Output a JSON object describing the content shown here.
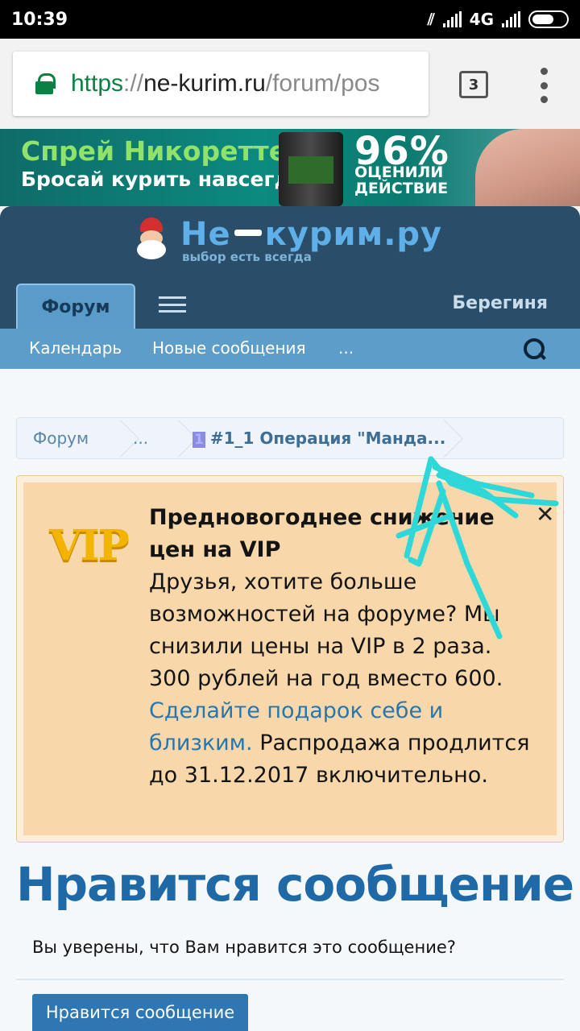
{
  "status_bar": {
    "time": "10:39",
    "network": "4G"
  },
  "browser": {
    "url_scheme": "https",
    "url_sep": "://",
    "url_host": "ne-kurim.ru",
    "url_path": "/forum/pos",
    "tab_count": "3"
  },
  "ad": {
    "line1": "Спрей Никоретте",
    "line2": "Бросай курить навсегда!",
    "percent": "96%",
    "rated_1": "ОЦЕНИЛИ",
    "rated_2": "ДЕЙСТВИЕ"
  },
  "site": {
    "logo_left": "Не",
    "logo_right": "курим.ру",
    "tagline": "выбор есть всегда",
    "tab_forum": "Форум",
    "username": "Берегиня"
  },
  "subnav": {
    "calendar": "Календарь",
    "new_posts": "Новые сообщения",
    "more": "..."
  },
  "breadcrumb": {
    "item1": "Форум",
    "item2": "...",
    "current_prefix": "1",
    "current": "#1_1 Операция \"Манда..."
  },
  "notice": {
    "title_1": "Предновогоднее снижение",
    "title_2": "цен на VIP",
    "body_1": "Друзья, хотите больше возможностей на форуме? Мы снизили цены на VIP в 2 раза. 300 рублей на год вместо 600.",
    "link": "Сделайте подарок себе и близким.",
    "body_2": "Распродажа продлится до 31.12.2017 включительно.",
    "close": "✕",
    "vip_label": "VIP"
  },
  "page": {
    "title": "Нравится сообщение",
    "confirm_text": "Вы уверены, что Вам нравится это сообщение?",
    "like_button": "Нравится сообщение"
  },
  "colors": {
    "header_bg": "#2a4d69",
    "subnav_bg": "#5d9dca",
    "notice_bg": "#f8d8aa",
    "title_color": "#1f6aa6",
    "button_bg": "#2f77b3",
    "scribble": "#2fd8d8"
  },
  "icons": {
    "lock": "lock-icon",
    "search": "search-icon",
    "menu": "hamburger-menu-icon",
    "close": "close-icon",
    "overflow": "three-dots-icon"
  }
}
